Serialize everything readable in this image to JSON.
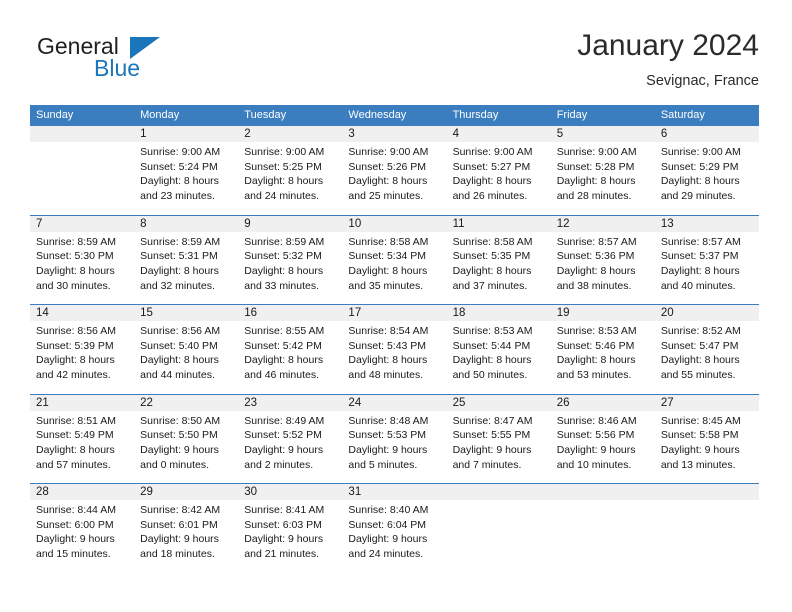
{
  "brand": {
    "name_part1": "General",
    "name_part2": "Blue",
    "triangle_color": "#1b75bb"
  },
  "header": {
    "title": "January 2024",
    "subtitle": "Sevignac, France"
  },
  "theme": {
    "header_blue": "#3a7ebf",
    "number_band": "#f0f0f0",
    "text": "#1a1a1a"
  },
  "weekdays": [
    "Sunday",
    "Monday",
    "Tuesday",
    "Wednesday",
    "Thursday",
    "Friday",
    "Saturday"
  ],
  "weeks": [
    [
      {
        "day": "",
        "sunrise": "",
        "sunset": "",
        "daylight1": "",
        "daylight2": ""
      },
      {
        "day": "1",
        "sunrise": "Sunrise: 9:00 AM",
        "sunset": "Sunset: 5:24 PM",
        "daylight1": "Daylight: 8 hours",
        "daylight2": "and 23 minutes."
      },
      {
        "day": "2",
        "sunrise": "Sunrise: 9:00 AM",
        "sunset": "Sunset: 5:25 PM",
        "daylight1": "Daylight: 8 hours",
        "daylight2": "and 24 minutes."
      },
      {
        "day": "3",
        "sunrise": "Sunrise: 9:00 AM",
        "sunset": "Sunset: 5:26 PM",
        "daylight1": "Daylight: 8 hours",
        "daylight2": "and 25 minutes."
      },
      {
        "day": "4",
        "sunrise": "Sunrise: 9:00 AM",
        "sunset": "Sunset: 5:27 PM",
        "daylight1": "Daylight: 8 hours",
        "daylight2": "and 26 minutes."
      },
      {
        "day": "5",
        "sunrise": "Sunrise: 9:00 AM",
        "sunset": "Sunset: 5:28 PM",
        "daylight1": "Daylight: 8 hours",
        "daylight2": "and 28 minutes."
      },
      {
        "day": "6",
        "sunrise": "Sunrise: 9:00 AM",
        "sunset": "Sunset: 5:29 PM",
        "daylight1": "Daylight: 8 hours",
        "daylight2": "and 29 minutes."
      }
    ],
    [
      {
        "day": "7",
        "sunrise": "Sunrise: 8:59 AM",
        "sunset": "Sunset: 5:30 PM",
        "daylight1": "Daylight: 8 hours",
        "daylight2": "and 30 minutes."
      },
      {
        "day": "8",
        "sunrise": "Sunrise: 8:59 AM",
        "sunset": "Sunset: 5:31 PM",
        "daylight1": "Daylight: 8 hours",
        "daylight2": "and 32 minutes."
      },
      {
        "day": "9",
        "sunrise": "Sunrise: 8:59 AM",
        "sunset": "Sunset: 5:32 PM",
        "daylight1": "Daylight: 8 hours",
        "daylight2": "and 33 minutes."
      },
      {
        "day": "10",
        "sunrise": "Sunrise: 8:58 AM",
        "sunset": "Sunset: 5:34 PM",
        "daylight1": "Daylight: 8 hours",
        "daylight2": "and 35 minutes."
      },
      {
        "day": "11",
        "sunrise": "Sunrise: 8:58 AM",
        "sunset": "Sunset: 5:35 PM",
        "daylight1": "Daylight: 8 hours",
        "daylight2": "and 37 minutes."
      },
      {
        "day": "12",
        "sunrise": "Sunrise: 8:57 AM",
        "sunset": "Sunset: 5:36 PM",
        "daylight1": "Daylight: 8 hours",
        "daylight2": "and 38 minutes."
      },
      {
        "day": "13",
        "sunrise": "Sunrise: 8:57 AM",
        "sunset": "Sunset: 5:37 PM",
        "daylight1": "Daylight: 8 hours",
        "daylight2": "and 40 minutes."
      }
    ],
    [
      {
        "day": "14",
        "sunrise": "Sunrise: 8:56 AM",
        "sunset": "Sunset: 5:39 PM",
        "daylight1": "Daylight: 8 hours",
        "daylight2": "and 42 minutes."
      },
      {
        "day": "15",
        "sunrise": "Sunrise: 8:56 AM",
        "sunset": "Sunset: 5:40 PM",
        "daylight1": "Daylight: 8 hours",
        "daylight2": "and 44 minutes."
      },
      {
        "day": "16",
        "sunrise": "Sunrise: 8:55 AM",
        "sunset": "Sunset: 5:42 PM",
        "daylight1": "Daylight: 8 hours",
        "daylight2": "and 46 minutes."
      },
      {
        "day": "17",
        "sunrise": "Sunrise: 8:54 AM",
        "sunset": "Sunset: 5:43 PM",
        "daylight1": "Daylight: 8 hours",
        "daylight2": "and 48 minutes."
      },
      {
        "day": "18",
        "sunrise": "Sunrise: 8:53 AM",
        "sunset": "Sunset: 5:44 PM",
        "daylight1": "Daylight: 8 hours",
        "daylight2": "and 50 minutes."
      },
      {
        "day": "19",
        "sunrise": "Sunrise: 8:53 AM",
        "sunset": "Sunset: 5:46 PM",
        "daylight1": "Daylight: 8 hours",
        "daylight2": "and 53 minutes."
      },
      {
        "day": "20",
        "sunrise": "Sunrise: 8:52 AM",
        "sunset": "Sunset: 5:47 PM",
        "daylight1": "Daylight: 8 hours",
        "daylight2": "and 55 minutes."
      }
    ],
    [
      {
        "day": "21",
        "sunrise": "Sunrise: 8:51 AM",
        "sunset": "Sunset: 5:49 PM",
        "daylight1": "Daylight: 8 hours",
        "daylight2": "and 57 minutes."
      },
      {
        "day": "22",
        "sunrise": "Sunrise: 8:50 AM",
        "sunset": "Sunset: 5:50 PM",
        "daylight1": "Daylight: 9 hours",
        "daylight2": "and 0 minutes."
      },
      {
        "day": "23",
        "sunrise": "Sunrise: 8:49 AM",
        "sunset": "Sunset: 5:52 PM",
        "daylight1": "Daylight: 9 hours",
        "daylight2": "and 2 minutes."
      },
      {
        "day": "24",
        "sunrise": "Sunrise: 8:48 AM",
        "sunset": "Sunset: 5:53 PM",
        "daylight1": "Daylight: 9 hours",
        "daylight2": "and 5 minutes."
      },
      {
        "day": "25",
        "sunrise": "Sunrise: 8:47 AM",
        "sunset": "Sunset: 5:55 PM",
        "daylight1": "Daylight: 9 hours",
        "daylight2": "and 7 minutes."
      },
      {
        "day": "26",
        "sunrise": "Sunrise: 8:46 AM",
        "sunset": "Sunset: 5:56 PM",
        "daylight1": "Daylight: 9 hours",
        "daylight2": "and 10 minutes."
      },
      {
        "day": "27",
        "sunrise": "Sunrise: 8:45 AM",
        "sunset": "Sunset: 5:58 PM",
        "daylight1": "Daylight: 9 hours",
        "daylight2": "and 13 minutes."
      }
    ],
    [
      {
        "day": "28",
        "sunrise": "Sunrise: 8:44 AM",
        "sunset": "Sunset: 6:00 PM",
        "daylight1": "Daylight: 9 hours",
        "daylight2": "and 15 minutes."
      },
      {
        "day": "29",
        "sunrise": "Sunrise: 8:42 AM",
        "sunset": "Sunset: 6:01 PM",
        "daylight1": "Daylight: 9 hours",
        "daylight2": "and 18 minutes."
      },
      {
        "day": "30",
        "sunrise": "Sunrise: 8:41 AM",
        "sunset": "Sunset: 6:03 PM",
        "daylight1": "Daylight: 9 hours",
        "daylight2": "and 21 minutes."
      },
      {
        "day": "31",
        "sunrise": "Sunrise: 8:40 AM",
        "sunset": "Sunset: 6:04 PM",
        "daylight1": "Daylight: 9 hours",
        "daylight2": "and 24 minutes."
      },
      {
        "day": "",
        "sunrise": "",
        "sunset": "",
        "daylight1": "",
        "daylight2": ""
      },
      {
        "day": "",
        "sunrise": "",
        "sunset": "",
        "daylight1": "",
        "daylight2": ""
      },
      {
        "day": "",
        "sunrise": "",
        "sunset": "",
        "daylight1": "",
        "daylight2": ""
      }
    ]
  ]
}
